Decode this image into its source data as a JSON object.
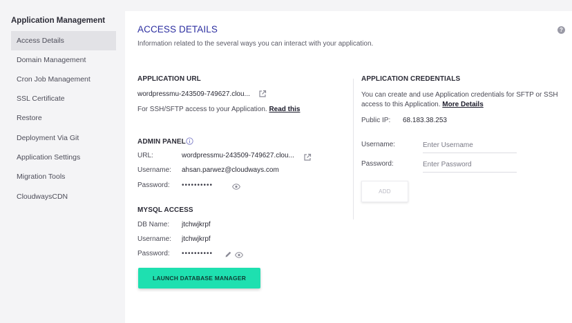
{
  "sidebar": {
    "title": "Application Management",
    "items": [
      {
        "label": "Access Details",
        "active": true
      },
      {
        "label": "Domain Management"
      },
      {
        "label": "Cron Job Management"
      },
      {
        "label": "SSL Certificate"
      },
      {
        "label": "Restore"
      },
      {
        "label": "Deployment Via Git"
      },
      {
        "label": "Application Settings"
      },
      {
        "label": "Migration Tools"
      },
      {
        "label": "CloudwaysCDN"
      }
    ]
  },
  "page": {
    "title": "ACCESS DETAILS",
    "subtitle": "Information related to the several ways you can interact with your application.",
    "help_icon": "question-circle-icon"
  },
  "app_url": {
    "heading": "APPLICATION URL",
    "url": "wordpressmu-243509-749627.clou...",
    "ssh_note": "For SSH/SFTP access to your Application.",
    "read_this": "Read this"
  },
  "admin_panel": {
    "heading": "ADMIN PANEL",
    "url_label": "URL:",
    "url": "wordpressmu-243509-749627.clou...",
    "username_label": "Username:",
    "username": "ahsan.parwez@cloudways.com",
    "password_label": "Password:",
    "password": "••••••••••"
  },
  "mysql": {
    "heading": "MYSQL ACCESS",
    "db_label": "DB Name:",
    "db_name": "jtchwjkrpf",
    "username_label": "Username:",
    "username": "jtchwjkrpf",
    "password_label": "Password:",
    "password": "••••••••••",
    "launch_button": "LAUNCH DATABASE MANAGER"
  },
  "credentials": {
    "heading": "APPLICATION CREDENTIALS",
    "description": "You can create and use Application credentials for SFTP or SSH access to this Application.",
    "more_details": "More Details",
    "public_ip_label": "Public IP:",
    "public_ip": "68.183.38.253",
    "username_label": "Username:",
    "username_placeholder": "Enter Username",
    "password_label": "Password:",
    "password_placeholder": "Enter Password",
    "add_button": "ADD"
  },
  "colors": {
    "accent_title": "#2c2ea0",
    "launch_button": "#1ee0b0",
    "sidebar_active": "#e2e2e6"
  }
}
